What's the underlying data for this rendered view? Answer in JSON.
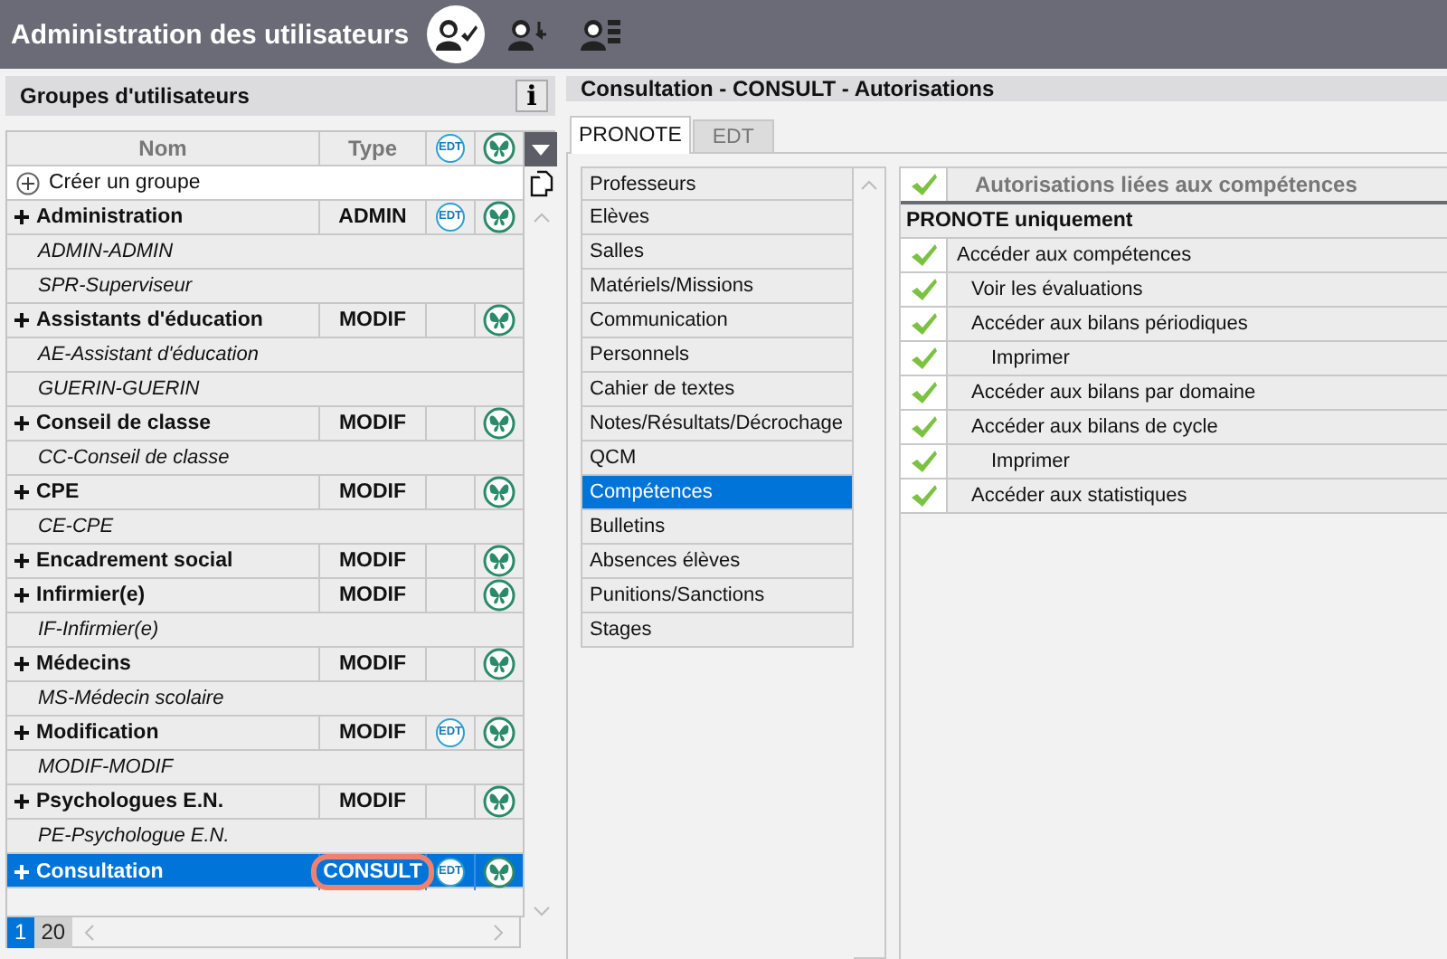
{
  "app": {
    "title": "Administration des utilisateurs",
    "tools": [
      {
        "kind": "user-check",
        "selected": true
      },
      {
        "kind": "user-arrow",
        "selected": false
      },
      {
        "kind": "user-list",
        "selected": false
      }
    ]
  },
  "groups": {
    "title": "Groupes d'utilisateurs",
    "info": "i",
    "columns": [
      {
        "kind": "name",
        "label": "Nom"
      },
      {
        "kind": "type",
        "label": "Type"
      },
      {
        "kind": "edt",
        "label": "EDT"
      },
      {
        "kind": "butterfly"
      }
    ],
    "create": "Créer un groupe",
    "rows": [
      {
        "name": "Administration",
        "type": "ADMIN",
        "edt_badge": "EDT",
        "butterfly": true,
        "selected": false,
        "children": [
          {
            "name": "ADMIN-ADMIN"
          },
          {
            "name": "SPR-Superviseur"
          }
        ]
      },
      {
        "name": "Assistants d'éducation",
        "type": "MODIF",
        "butterfly": true,
        "selected": false,
        "children": [
          {
            "name": "AE-Assistant d'éducation"
          },
          {
            "name": "GUERIN-GUERIN"
          }
        ]
      },
      {
        "name": "Conseil de classe",
        "type": "MODIF",
        "butterfly": true,
        "selected": false,
        "children": [
          {
            "name": "CC-Conseil de classe"
          }
        ]
      },
      {
        "name": "CPE",
        "type": "MODIF",
        "butterfly": true,
        "selected": false,
        "children": [
          {
            "name": "CE-CPE"
          }
        ]
      },
      {
        "name": "Encadrement social",
        "type": "MODIF",
        "butterfly": true,
        "selected": false
      },
      {
        "name": "Infirmier(e)",
        "type": "MODIF",
        "butterfly": true,
        "selected": false,
        "children": [
          {
            "name": "IF-Infirmier(e)"
          }
        ]
      },
      {
        "name": "Médecins",
        "type": "MODIF",
        "butterfly": true,
        "selected": false,
        "children": [
          {
            "name": "MS-Médecin scolaire"
          }
        ]
      },
      {
        "name": "Modification",
        "type": "MODIF",
        "edt_badge": "EDT",
        "butterfly": true,
        "selected": false,
        "children": [
          {
            "name": "MODIF-MODIF"
          }
        ]
      },
      {
        "name": "Psychologues E.N.",
        "type": "MODIF",
        "butterfly": true,
        "selected": false,
        "children": [
          {
            "name": "PE-Psychologue E.N."
          }
        ]
      },
      {
        "name": "Consultation",
        "type": "CONSULT",
        "edt_badge": "EDT",
        "butterfly": true,
        "selected": true,
        "highlighted": true
      }
    ],
    "pages": [
      {
        "label": "1",
        "selected": true
      },
      {
        "label": "20",
        "selected": false
      }
    ]
  },
  "authorizations": {
    "title": "Consultation - CONSULT - Autorisations",
    "tabs": [
      {
        "label": "PRONOTE",
        "selected": true
      },
      {
        "label": "EDT",
        "selected": false
      }
    ],
    "categories": [
      {
        "label": "Professeurs",
        "selected": false
      },
      {
        "label": "Elèves",
        "selected": false
      },
      {
        "label": "Salles",
        "selected": false
      },
      {
        "label": "Matériels/Missions",
        "selected": false
      },
      {
        "label": "Communication",
        "selected": false
      },
      {
        "label": "Personnels",
        "selected": false
      },
      {
        "label": "Cahier de textes",
        "selected": false
      },
      {
        "label": "Notes/Résultats/Décrochage",
        "selected": false
      },
      {
        "label": "QCM",
        "selected": false
      },
      {
        "label": "Compétences",
        "selected": true
      },
      {
        "label": "Bulletins",
        "selected": false
      },
      {
        "label": "Absences élèves",
        "selected": false
      },
      {
        "label": "Punitions/Sanctions",
        "selected": false
      },
      {
        "label": "Stages",
        "selected": false
      }
    ],
    "header": {
      "label": "Autorisations liées aux compétences",
      "checked": true
    },
    "section": "PRONOTE uniquement",
    "items": [
      {
        "label": "Accéder aux compétences",
        "checked": true,
        "children": [
          {
            "label": "Voir les évaluations",
            "checked": true
          },
          {
            "label": "Accéder aux bilans périodiques",
            "checked": true,
            "children": [
              {
                "label": "Imprimer",
                "checked": true
              }
            ]
          },
          {
            "label": "Accéder aux bilans par domaine",
            "checked": true
          },
          {
            "label": "Accéder aux bilans de cycle",
            "checked": true,
            "children": [
              {
                "label": "Imprimer",
                "checked": true
              }
            ]
          },
          {
            "label": "Accéder aux statistiques",
            "checked": true
          }
        ]
      }
    ]
  }
}
